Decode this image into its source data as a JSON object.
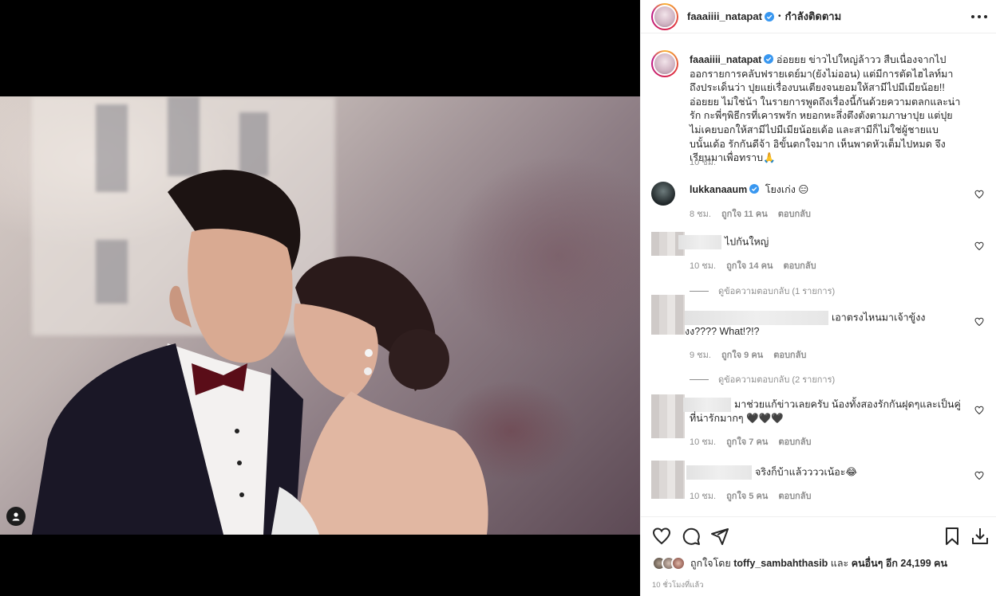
{
  "post": {
    "username": "faaaiiii_natapat",
    "follow_label": "กำลังติดตาม",
    "caption": "อ่อยยย ข่าวไปใหญ่ล้าวว สืบเนื่องจากไปออกรายการคลับฟรายเดย์มา(ยังไม่ออน) แต่มีการตัดไฮไลท์มาถึงประเด็นว่า ปุยแย่เรื่องบนเตียงจนยอมให้สามีไปมีเมียน้อย!! อ่อยยย ไม่ใช่น้า ในรายการพูดถึงเรื่องนี้กันด้วยความตลกและน่ารัก กะพี่ๆพิธีกรที่เคารพรัก หยอกหะลึ่งตึงตังตามภาษาปุย แต่ปุยไม่เคยบอกให้สามีไปมีเมียน้อยเด้อ และสามีก็ไม่ใช่ผู้ชายแบบนั้นเด้อ รักกันดีจ้า อิขั้นตกใจมาก เห็นพาดหัวเต็มไปหมด จึงเรียนมาเพื่อทราบ🙏",
    "caption_time": "10 ชม."
  },
  "comments": [
    {
      "user": "lukkanaaum",
      "verified": true,
      "text": "โยงเก่ง 😑",
      "time": "8 ชม.",
      "likes": "ถูกใจ 11 คน",
      "reply": "ตอบกลับ"
    },
    {
      "user": "",
      "text": "ไปกันใหญ่",
      "time": "10 ชม.",
      "likes": "ถูกใจ 14 คน",
      "reply": "ตอบกลับ",
      "view_replies": "ดูข้อความตอบกลับ (1 รายการ)"
    },
    {
      "user": "",
      "text": "เอาตรงไหนมาเจ้าขู้งงงง???? What!?!?",
      "time": "9 ชม.",
      "likes": "ถูกใจ 9 คน",
      "reply": "ตอบกลับ",
      "view_replies": "ดูข้อความตอบกลับ (2 รายการ)"
    },
    {
      "user": "",
      "text": "มาช่วยแก้ข่าวเลยครับ น้องทั้งสองรักกันฝุดๆและเป็นคู่ที่น่ารักมากๆ 🖤🖤🖤",
      "time": "10 ชม.",
      "likes": "ถูกใจ 7 คน",
      "reply": "ตอบกลับ"
    },
    {
      "user": "",
      "text": "จริงก็บ้าแล้ววววเน้อะ😂",
      "time": "10 ชม.",
      "likes": "ถูกใจ 5 คน",
      "reply": "ตอบกลับ"
    }
  ],
  "likes_summary": {
    "prefix": "ถูกใจโดย",
    "user": "toffy_sambahthasib",
    "joiner": "และ",
    "others": "คนอื่นๆ อีก 24,199 คน"
  },
  "time_ago": "10 ชั่วโมงที่แล้ว",
  "icons": [
    "verified-badge-icon",
    "more-options-icon",
    "heart-icon",
    "comment-icon",
    "share-icon",
    "bookmark-icon",
    "download-icon",
    "user-tag-icon"
  ],
  "colors": {
    "verified": "#3897f0",
    "muted": "#8e8e8e",
    "text": "#262626"
  }
}
